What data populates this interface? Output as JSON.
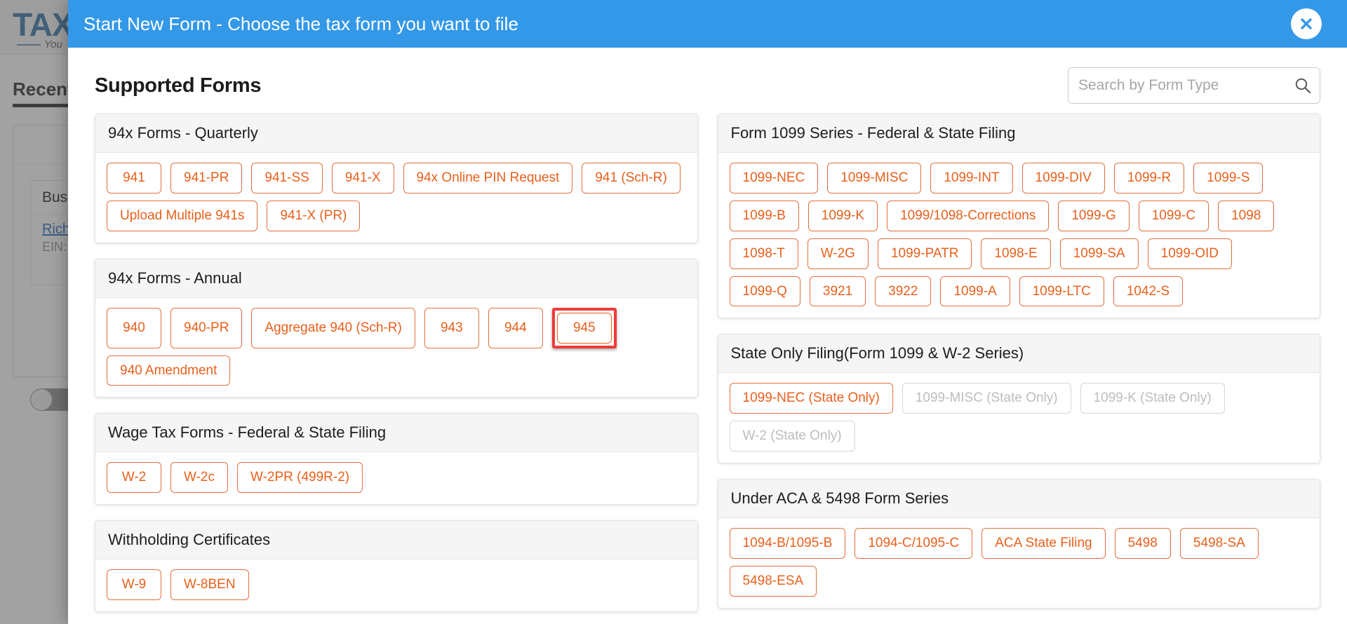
{
  "background": {
    "logo": "TAX",
    "tagline": "You",
    "tab_label": "Recent",
    "card_business_label": "Business",
    "card_business_name": "Rich",
    "card_ein_label": "EIN:"
  },
  "modal": {
    "title": "Start New Form - Choose the tax form you want to file",
    "close_icon": "close-icon",
    "section_title": "Supported Forms",
    "search": {
      "placeholder": "Search by Form Type",
      "value": "",
      "icon": "search-icon"
    },
    "highlight_color": "#ef3b39",
    "accent_color": "#e8601c",
    "header_color": "#3498e8"
  },
  "left_column": [
    {
      "title": "94x Forms - Quarterly",
      "buttons": [
        {
          "label": "941",
          "disabled": false,
          "highlighted": false
        },
        {
          "label": "941-PR",
          "disabled": false,
          "highlighted": false
        },
        {
          "label": "941-SS",
          "disabled": false,
          "highlighted": false
        },
        {
          "label": "941-X",
          "disabled": false,
          "highlighted": false
        },
        {
          "label": "94x Online PIN Request",
          "disabled": false,
          "highlighted": false
        },
        {
          "label": "941 (Sch-R)",
          "disabled": false,
          "highlighted": false
        },
        {
          "label": "Upload Multiple 941s",
          "disabled": false,
          "highlighted": false
        },
        {
          "label": "941-X (PR)",
          "disabled": false,
          "highlighted": false
        }
      ]
    },
    {
      "title": "94x Forms - Annual",
      "buttons": [
        {
          "label": "940",
          "disabled": false,
          "highlighted": false
        },
        {
          "label": "940-PR",
          "disabled": false,
          "highlighted": false
        },
        {
          "label": "Aggregate 940 (Sch-R)",
          "disabled": false,
          "highlighted": false
        },
        {
          "label": "943",
          "disabled": false,
          "highlighted": false
        },
        {
          "label": "944",
          "disabled": false,
          "highlighted": false
        },
        {
          "label": "945",
          "disabled": false,
          "highlighted": true
        },
        {
          "label": "940 Amendment",
          "disabled": false,
          "highlighted": false
        }
      ]
    },
    {
      "title": "Wage Tax Forms - Federal & State Filing",
      "buttons": [
        {
          "label": "W-2",
          "disabled": false,
          "highlighted": false
        },
        {
          "label": "W-2c",
          "disabled": false,
          "highlighted": false
        },
        {
          "label": "W-2PR (499R-2)",
          "disabled": false,
          "highlighted": false
        }
      ]
    },
    {
      "title": "Withholding Certificates",
      "buttons": [
        {
          "label": "W-9",
          "disabled": false,
          "highlighted": false
        },
        {
          "label": "W-8BEN",
          "disabled": false,
          "highlighted": false
        }
      ]
    }
  ],
  "right_column": [
    {
      "title": "Form 1099 Series - Federal & State Filing",
      "buttons": [
        {
          "label": "1099-NEC",
          "disabled": false,
          "highlighted": false
        },
        {
          "label": "1099-MISC",
          "disabled": false,
          "highlighted": false
        },
        {
          "label": "1099-INT",
          "disabled": false,
          "highlighted": false
        },
        {
          "label": "1099-DIV",
          "disabled": false,
          "highlighted": false
        },
        {
          "label": "1099-R",
          "disabled": false,
          "highlighted": false
        },
        {
          "label": "1099-S",
          "disabled": false,
          "highlighted": false
        },
        {
          "label": "1099-B",
          "disabled": false,
          "highlighted": false
        },
        {
          "label": "1099-K",
          "disabled": false,
          "highlighted": false
        },
        {
          "label": "1099/1098-Corrections",
          "disabled": false,
          "highlighted": false
        },
        {
          "label": "1099-G",
          "disabled": false,
          "highlighted": false
        },
        {
          "label": "1099-C",
          "disabled": false,
          "highlighted": false
        },
        {
          "label": "1098",
          "disabled": false,
          "highlighted": false
        },
        {
          "label": "1098-T",
          "disabled": false,
          "highlighted": false
        },
        {
          "label": "W-2G",
          "disabled": false,
          "highlighted": false
        },
        {
          "label": "1099-PATR",
          "disabled": false,
          "highlighted": false
        },
        {
          "label": "1098-E",
          "disabled": false,
          "highlighted": false
        },
        {
          "label": "1099-SA",
          "disabled": false,
          "highlighted": false
        },
        {
          "label": "1099-OID",
          "disabled": false,
          "highlighted": false
        },
        {
          "label": "1099-Q",
          "disabled": false,
          "highlighted": false
        },
        {
          "label": "3921",
          "disabled": false,
          "highlighted": false
        },
        {
          "label": "3922",
          "disabled": false,
          "highlighted": false
        },
        {
          "label": "1099-A",
          "disabled": false,
          "highlighted": false
        },
        {
          "label": "1099-LTC",
          "disabled": false,
          "highlighted": false
        },
        {
          "label": "1042-S",
          "disabled": false,
          "highlighted": false
        }
      ]
    },
    {
      "title": "State Only Filing(Form 1099 & W-2 Series)",
      "buttons": [
        {
          "label": "1099-NEC (State Only)",
          "disabled": false,
          "highlighted": false
        },
        {
          "label": "1099-MISC (State Only)",
          "disabled": true,
          "highlighted": false
        },
        {
          "label": "1099-K (State Only)",
          "disabled": true,
          "highlighted": false
        },
        {
          "label": "W-2 (State Only)",
          "disabled": true,
          "highlighted": false
        }
      ]
    },
    {
      "title": "Under ACA & 5498 Form Series",
      "buttons": [
        {
          "label": "1094-B/1095-B",
          "disabled": false,
          "highlighted": false
        },
        {
          "label": "1094-C/1095-C",
          "disabled": false,
          "highlighted": false
        },
        {
          "label": "ACA State Filing",
          "disabled": false,
          "highlighted": false
        },
        {
          "label": "5498",
          "disabled": false,
          "highlighted": false
        },
        {
          "label": "5498-SA",
          "disabled": false,
          "highlighted": false
        },
        {
          "label": "5498-ESA",
          "disabled": false,
          "highlighted": false
        }
      ]
    }
  ]
}
